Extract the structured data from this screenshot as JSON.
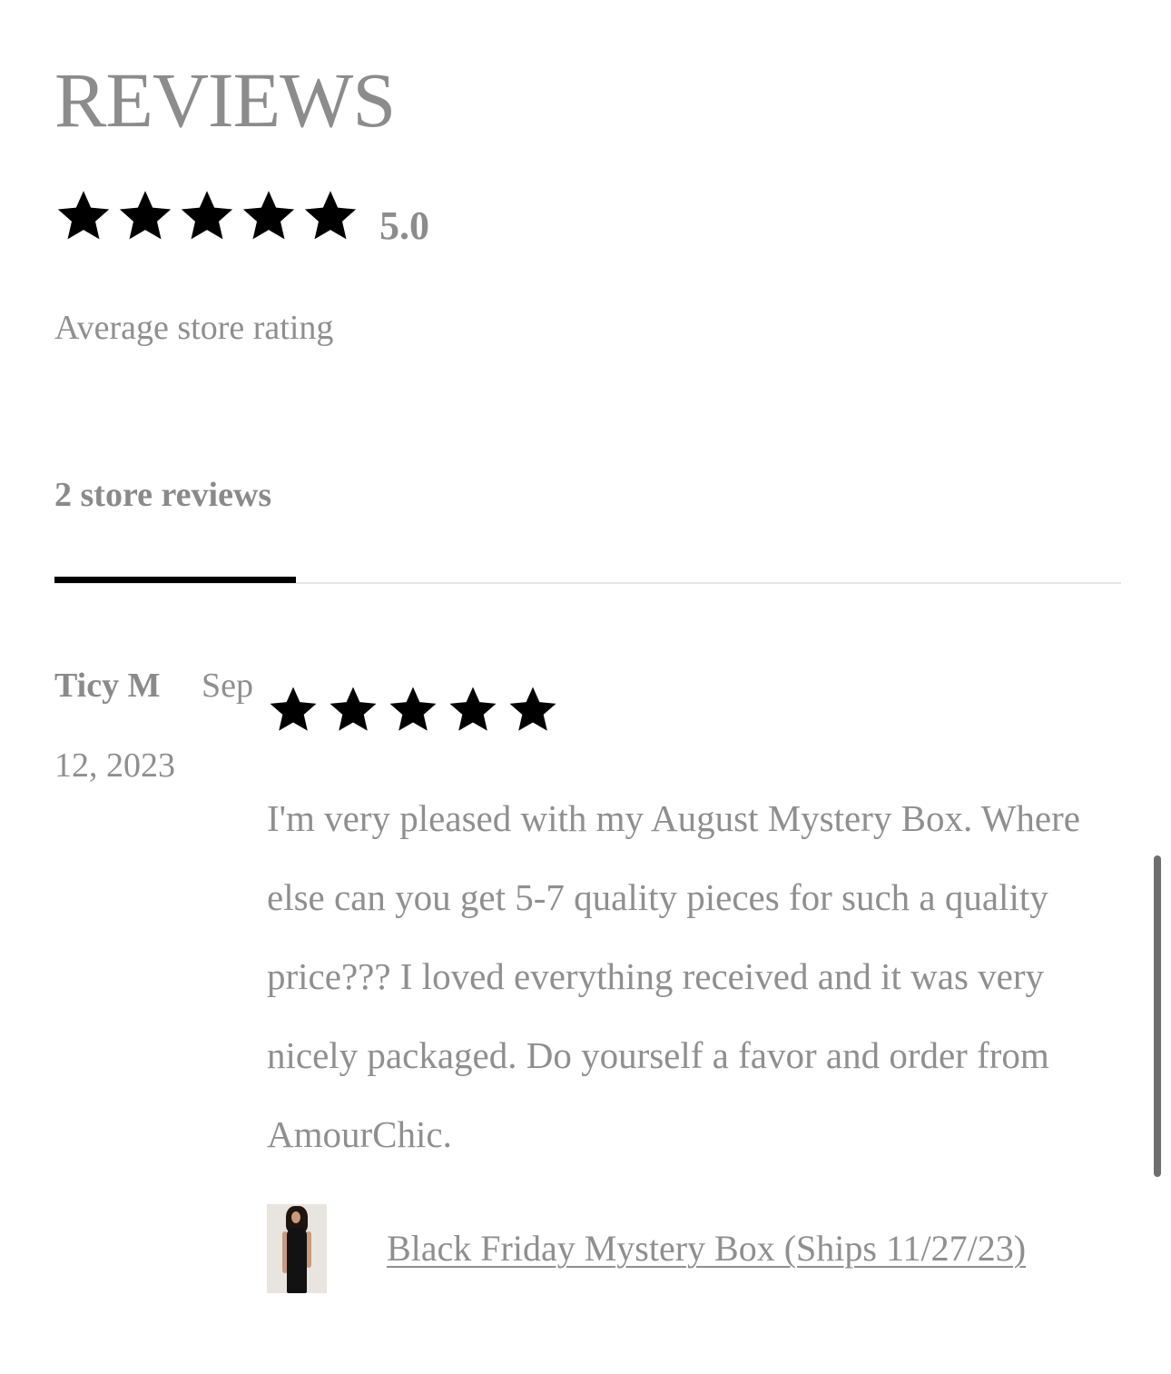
{
  "header": {
    "title": "REVIEWS"
  },
  "summary": {
    "rating": 5,
    "max_rating": 5,
    "score_text": "5.0",
    "caption": "Average store rating",
    "star_icon": "star-icon",
    "star_color": "#000000"
  },
  "tabs": [
    {
      "label": "2 store reviews",
      "active": true
    }
  ],
  "reviews": [
    {
      "author": "Ticy M",
      "date_line1": "Sep",
      "date_line2": "12, 2023",
      "rating": 5,
      "body": "I'm very pleased with my August Mystery Box. Where else can you get 5-7 quality pieces for such a quality price??? I loved everything received and it was very nicely packaged. Do yourself a favor and order from AmourChic.",
      "product": {
        "name": "Black Friday Mystery Box (Ships 11/27/23)",
        "thumbnail_icon": "product-thumbnail"
      }
    }
  ],
  "colors": {
    "text_gray": "#8f8f8f",
    "tab_underline": "#000000",
    "divider": "#e6e6e6",
    "scrollbar": "#6e6e6e"
  }
}
